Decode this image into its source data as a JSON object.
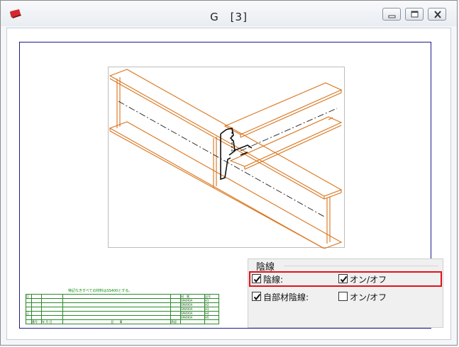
{
  "window": {
    "title": "G　[3]"
  },
  "icons": {
    "app": "app-logo-icon",
    "minimize": "minimize-icon",
    "maximize": "maximize-icon",
    "close": "close-icon",
    "check": "check-icon"
  },
  "colors": {
    "beam": "#d9731a",
    "border": "#1a1a8c",
    "highlight": "#e0121a",
    "title_block": "#2a8a2a"
  },
  "title_block": {
    "note": "特記なきすべての材料はSS400とする。",
    "side_labels": [
      "訂",
      "正"
    ],
    "right_col_header": [
      "材　質",
      "記号"
    ],
    "footer": [
      "番号",
      "年 月 日",
      "記　　事",
      "承認"
    ],
    "rows": [
      {
        "mat": "SM490A",
        "code": "H1"
      },
      {
        "mat": "SM490A",
        "code": "H2"
      },
      {
        "mat": "SM490A",
        "code": "H3"
      },
      {
        "mat": "SM490A",
        "code": "H4"
      },
      {
        "mat": "SM490A",
        "code": "H5"
      }
    ]
  },
  "hidden_line_panel": {
    "title": "陰線",
    "row1": {
      "label": "陰線:",
      "checked": true,
      "toggle_label": "オン/オフ",
      "toggle_checked": true
    },
    "row2": {
      "label": "自部材陰線:",
      "checked": true,
      "toggle_label": "オン/オフ",
      "toggle_checked": false
    }
  }
}
